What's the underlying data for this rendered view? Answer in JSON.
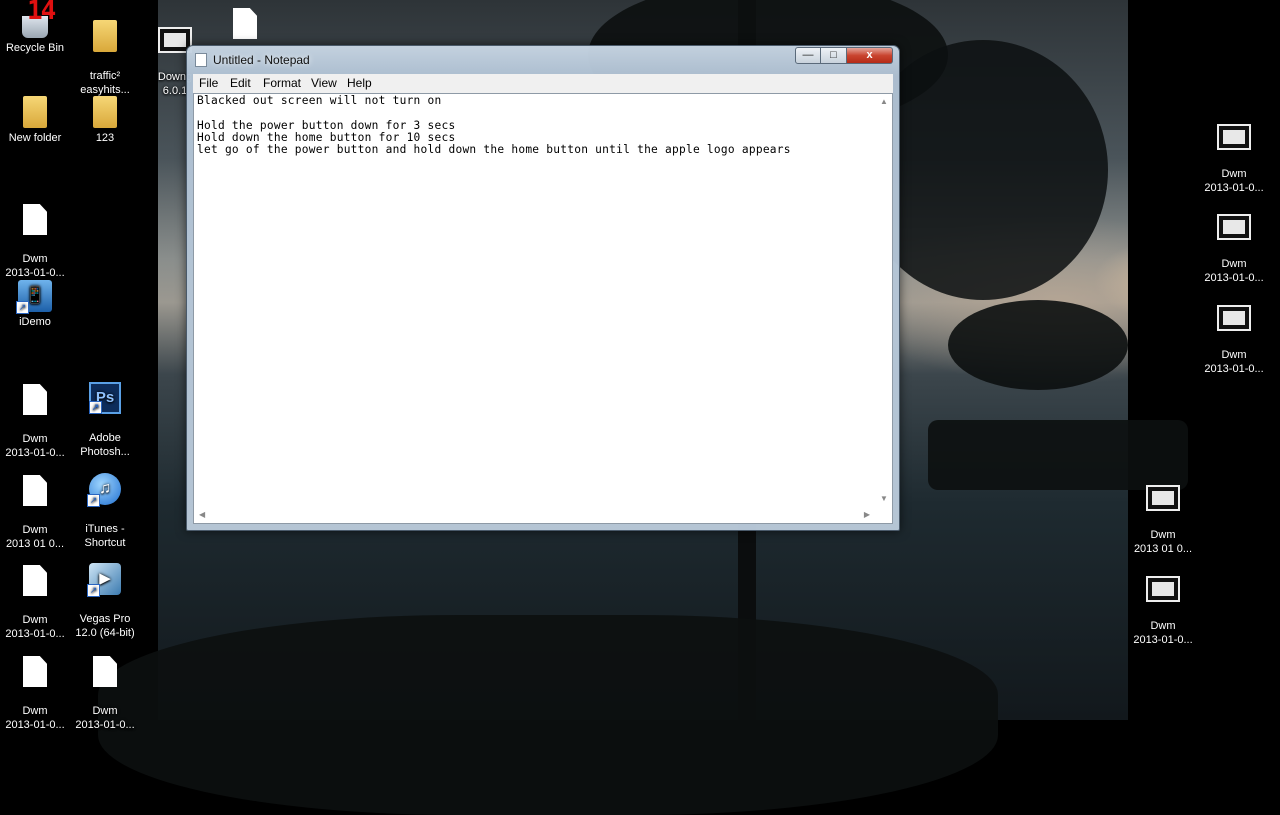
{
  "desktop": {
    "recycle_count": "14",
    "left_icons": [
      {
        "label": "Recycle Bin",
        "icon": "recycle-bin-icon"
      },
      {
        "label": "traffic²\neasyhits...",
        "icon": "folder-icon"
      },
      {
        "label": "Downg\n6.0.1",
        "icon": "video-file-icon"
      },
      {
        "label": "New folder",
        "icon": "folder-icon"
      },
      {
        "label": "123",
        "icon": "folder-icon"
      },
      {
        "label": "Dwm\n2013-01-0...",
        "icon": "file-icon"
      },
      {
        "label": "iDemo",
        "icon": "idemo-icon"
      },
      {
        "label": "Dwm\n2013-01-0...",
        "icon": "file-icon"
      },
      {
        "label": "Adobe\nPhotosh...",
        "icon": "photoshop-icon"
      },
      {
        "label": "Dwm\n2013 01 0...",
        "icon": "file-icon"
      },
      {
        "label": "iTunes -\nShortcut",
        "icon": "itunes-icon"
      },
      {
        "label": "Dwm\n2013-01-0...",
        "icon": "file-icon"
      },
      {
        "label": "Vegas Pro\n12.0 (64-bit)",
        "icon": "vegas-icon"
      },
      {
        "label": "Dwm\n2013-01-0...",
        "icon": "file-icon"
      },
      {
        "label": "Dwm\n2013-01-0...",
        "icon": "file-icon"
      }
    ],
    "right_icons": [
      {
        "label": "Dwm\n2013-01-0...",
        "icon": "video-file-icon"
      },
      {
        "label": "Dwm\n2013-01-0...",
        "icon": "video-file-icon"
      },
      {
        "label": "Dwm\n2013-01-0...",
        "icon": "video-file-icon"
      },
      {
        "label": "Dwm\n2013 01 0...",
        "icon": "video-file-icon"
      },
      {
        "label": "Dwm\n2013-01-0...",
        "icon": "video-file-icon"
      }
    ]
  },
  "notepad": {
    "title": "Untitled - Notepad",
    "controls": {
      "minimize": "—",
      "maximize": "□",
      "close": "x"
    },
    "menu": [
      "File",
      "Edit",
      "Format",
      "View",
      "Help"
    ],
    "text": "Blacked out screen will not turn on\n\nHold the power button down for 3 secs\nHold down the home button for 10 secs\nlet go of the power button and hold down the home button until the apple logo appears"
  }
}
